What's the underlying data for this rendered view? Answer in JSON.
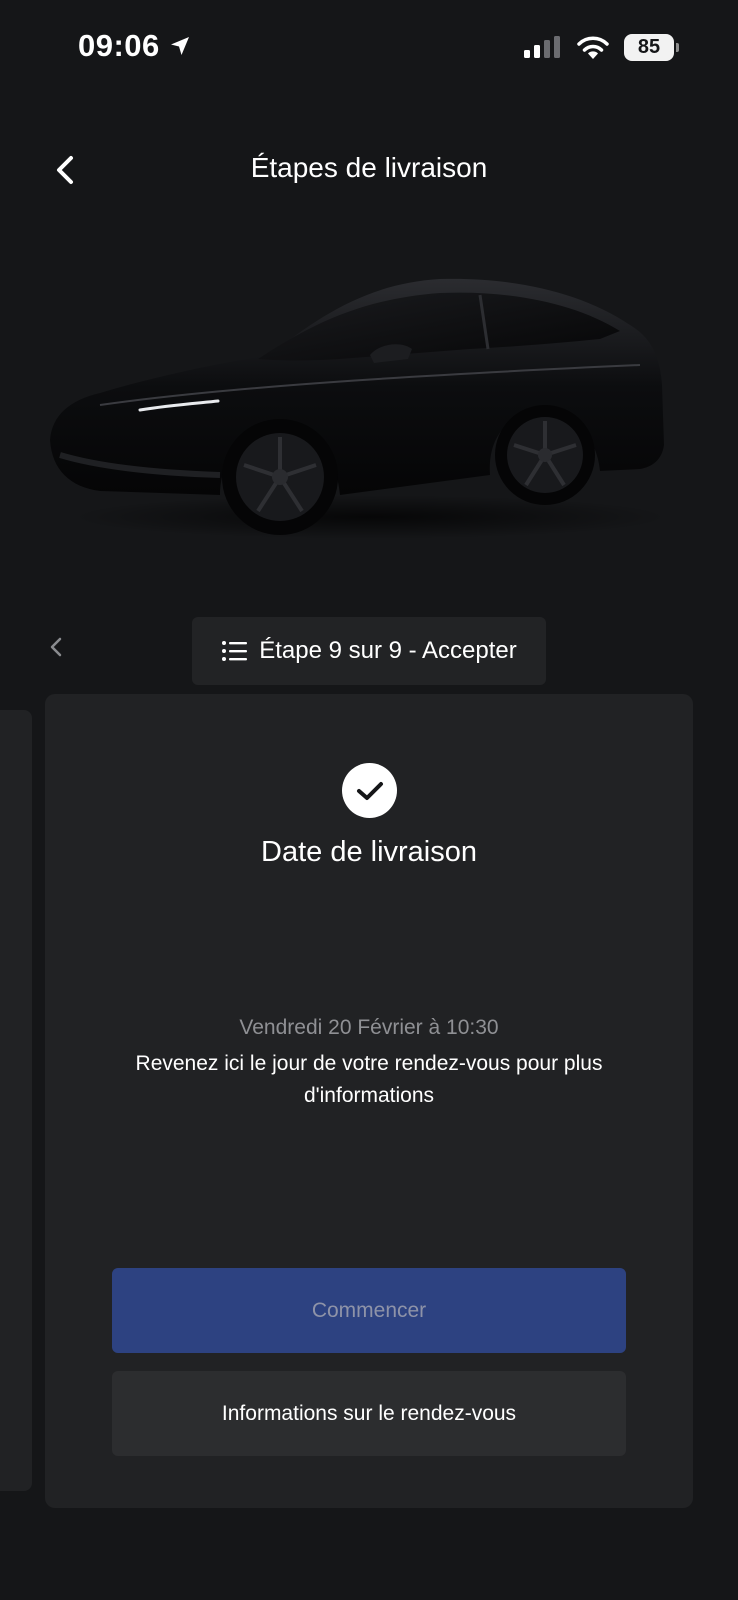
{
  "status_bar": {
    "time": "09:06",
    "battery": "85"
  },
  "header": {
    "title": "Étapes de livraison"
  },
  "step_selector": {
    "label": "Étape 9 sur 9 - Accepter"
  },
  "card": {
    "title": "Date de livraison",
    "date": "Vendredi 20 Février à 10:30",
    "info": "Revenez ici le jour de votre rendez-vous pour plus d'informations",
    "primary_button": "Commencer",
    "secondary_button": "Informations sur le rendez-vous"
  },
  "colors": {
    "background": "#151618",
    "card": "#212224",
    "primary_button": "#2d4281",
    "secondary_button": "#2c2d2f"
  }
}
